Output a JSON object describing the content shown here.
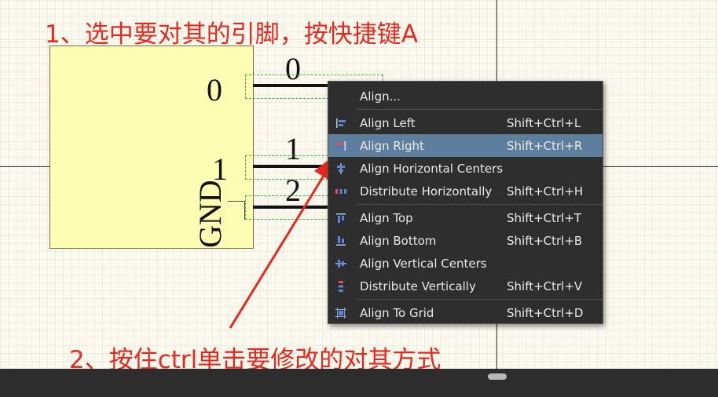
{
  "annotations": {
    "step1": "1、选中要对其的引脚，按快捷键A",
    "step2": "2、按住ctrl单击要修改的对其方式"
  },
  "component": {
    "body_label": "0",
    "pins": [
      {
        "number": "0"
      },
      {
        "number": "1"
      },
      {
        "number": "2"
      }
    ],
    "gnd_label": "GND",
    "pin1_label": "1"
  },
  "menu": {
    "items": [
      {
        "label": "Align...",
        "shortcut": "",
        "icon": "align-dialog"
      },
      {
        "label": "Align Left",
        "shortcut": "Shift+Ctrl+L",
        "icon": "align-left-icon"
      },
      {
        "label": "Align Right",
        "shortcut": "Shift+Ctrl+R",
        "icon": "align-right-icon",
        "active": true
      },
      {
        "label": "Align Horizontal Centers",
        "shortcut": "",
        "icon": "align-horizontal-centers-icon"
      },
      {
        "label": "Distribute Horizontally",
        "shortcut": "Shift+Ctrl+H",
        "icon": "distribute-horizontally-icon"
      },
      {
        "label": "Align Top",
        "shortcut": "Shift+Ctrl+T",
        "icon": "align-top-icon"
      },
      {
        "label": "Align Bottom",
        "shortcut": "Shift+Ctrl+B",
        "icon": "align-bottom-icon"
      },
      {
        "label": "Align Vertical Centers",
        "shortcut": "",
        "icon": "align-vertical-centers-icon"
      },
      {
        "label": "Distribute Vertically",
        "shortcut": "Shift+Ctrl+V",
        "icon": "distribute-vertically-icon"
      },
      {
        "label": "Align To Grid",
        "shortcut": "Shift+Ctrl+D",
        "icon": "align-to-grid-icon"
      }
    ]
  },
  "colors": {
    "annotation": "#e8281e",
    "menu_bg": "#2e2e2e",
    "menu_active": "#5d7f9d",
    "component_fill": "#fdfdb4",
    "selection": "#38b838"
  }
}
